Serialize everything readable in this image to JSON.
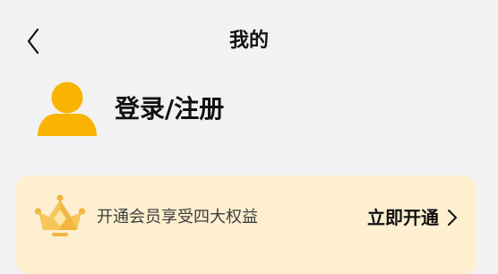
{
  "header": {
    "title": "我的",
    "back_icon": "chevron-left-icon"
  },
  "profile": {
    "avatar_icon": "default-user-avatar-icon",
    "login_label": "登录/注册",
    "avatar_color": "#F8B400"
  },
  "vip_card": {
    "icon": "crown-icon",
    "promo_text": "开通会员享受四大权益",
    "action_label": "立即开通",
    "action_icon": "chevron-right-icon",
    "background_color": "#FDEFD0"
  },
  "colors": {
    "page_background": "#F2F2F2",
    "primary_text": "#111111",
    "accent": "#F8B400"
  }
}
